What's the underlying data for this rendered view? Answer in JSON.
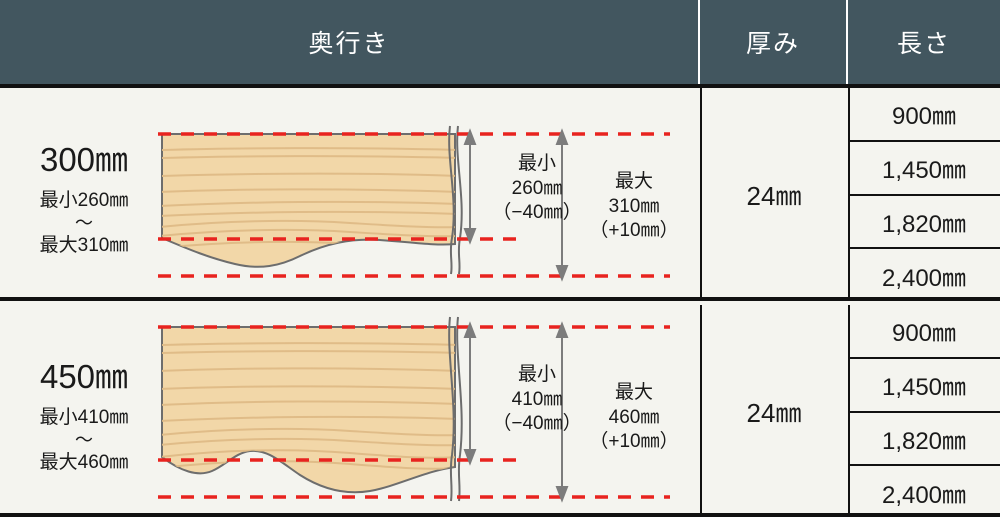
{
  "header": {
    "depth_label": "奥行き",
    "thickness_label": "厚み",
    "length_label": "長さ"
  },
  "colors": {
    "header_bg": "#42565f",
    "page_bg": "#f4f4ef",
    "wood_fill": "#f2d7a8",
    "wood_grain": "#dfbb86",
    "wood_outline": "#6d6d6d",
    "dashed_red": "#e8231f",
    "arrow_gray": "#7c7c7c",
    "border": "#111111",
    "text": "#1a1a1a"
  },
  "rows": [
    {
      "label": {
        "size": "300㎜",
        "min": "最小260㎜",
        "tilde": "〜",
        "max": "最大310㎜"
      },
      "dimensions": {
        "min": {
          "title": "最小",
          "value": "260㎜",
          "tolerance": "（−40㎜）"
        },
        "max": {
          "title": "最大",
          "value": "310㎜",
          "tolerance": "（+10㎜）"
        }
      },
      "thickness": "24㎜",
      "lengths": [
        "900㎜",
        "1,450㎜",
        "1,820㎜",
        "2,400㎜"
      ]
    },
    {
      "label": {
        "size": "450㎜",
        "min": "最小410㎜",
        "tilde": "〜",
        "max": "最大460㎜"
      },
      "dimensions": {
        "min": {
          "title": "最小",
          "value": "410㎜",
          "tolerance": "（−40㎜）"
        },
        "max": {
          "title": "最大",
          "value": "460㎜",
          "tolerance": "（+10㎜）"
        }
      },
      "thickness": "24㎜",
      "lengths": [
        "900㎜",
        "1,450㎜",
        "1,820㎜",
        "2,400㎜"
      ]
    }
  ]
}
